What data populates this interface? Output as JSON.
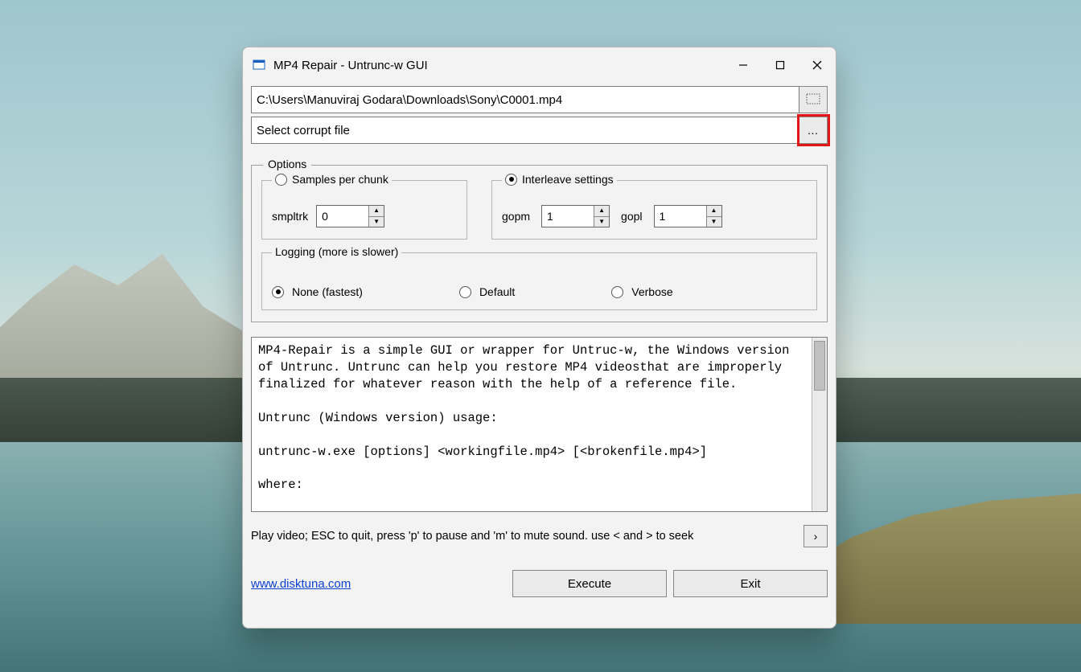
{
  "window": {
    "title": "MP4 Repair - Untrunc-w GUI"
  },
  "files": {
    "reference_path": "C:\\Users\\Manuviraj Godara\\Downloads\\Sony\\C0001.mp4",
    "corrupt_placeholder": "Select corrupt file"
  },
  "options": {
    "legend": "Options",
    "samples": {
      "legend": "Samples per chunk",
      "label": "smpltrk",
      "value": "0",
      "selected": false
    },
    "interleave": {
      "legend": "Interleave settings",
      "gopm_label": "gopm",
      "gopm_value": "1",
      "gopl_label": "gopl",
      "gopl_value": "1",
      "selected": true
    },
    "logging": {
      "legend": "Logging  (more is slower)",
      "none": "None (fastest)",
      "default": "Default",
      "verbose": "Verbose",
      "selected": "none"
    }
  },
  "info_text": "MP4-Repair is a simple GUI or wrapper for Untruc-w, the Windows version of Untrunc. Untrunc can help you restore MP4 videosthat are improperly finalized for whatever reason with the help of a reference file.\n\nUntrunc (Windows version) usage:\n\nuntrunc-w.exe [options] <workingfile.mp4> [<brokenfile.mp4>]\n\nwhere:",
  "hint": "Play video; ESC to quit, press 'p' to pause and 'm' to mute sound. use < and > to seek",
  "link": "www.disktuna.com",
  "buttons": {
    "execute": "Execute",
    "exit": "Exit"
  }
}
